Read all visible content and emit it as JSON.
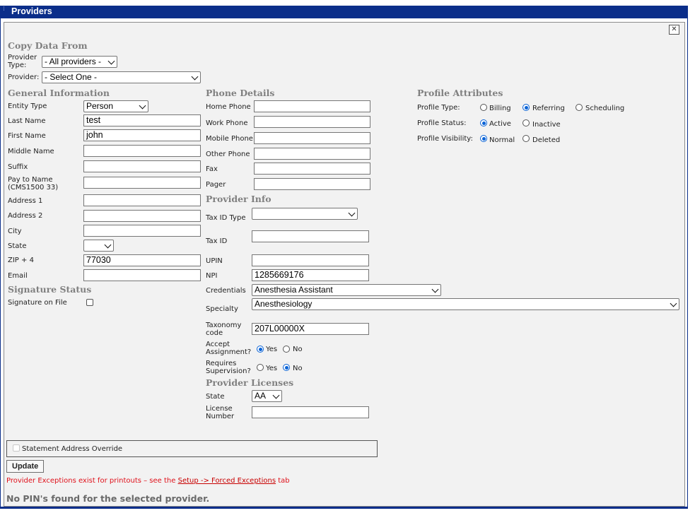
{
  "window": {
    "title": "Providers",
    "close_icon": "close-icon"
  },
  "copy": {
    "heading": "Copy Data From",
    "provider_type_label": "Provider Type:",
    "provider_type_value": "- All providers -",
    "provider_label": "Provider:",
    "provider_value": "- Select One -"
  },
  "general": {
    "heading": "General Information",
    "entity_type_label": "Entity Type",
    "entity_type_value": "Person",
    "last_name_label": "Last Name",
    "last_name_value": "test",
    "first_name_label": "First Name",
    "first_name_value": "john",
    "middle_name_label": "Middle Name",
    "middle_name_value": "",
    "suffix_label": "Suffix",
    "suffix_value": "",
    "pay_to_name_label": "Pay to Name (CMS1500 33)",
    "pay_to_name_value": "",
    "address1_label": "Address 1",
    "address1_value": "",
    "address2_label": "Address 2",
    "address2_value": "",
    "city_label": "City",
    "city_value": "",
    "state_label": "State",
    "state_value": "",
    "zip_label": "ZIP + 4",
    "zip_value": "77030",
    "email_label": "Email",
    "email_value": ""
  },
  "signature": {
    "heading": "Signature Status",
    "on_file_label": "Signature on File",
    "on_file_checked": false
  },
  "phone": {
    "heading": "Phone Details",
    "home_label": "Home Phone",
    "home_value": "",
    "work_label": "Work Phone",
    "work_value": "",
    "mobile_label": "Mobile Phone",
    "mobile_value": "",
    "other_label": "Other Phone",
    "other_value": "",
    "fax_label": "Fax",
    "fax_value": "",
    "pager_label": "Pager",
    "pager_value": ""
  },
  "provider_info": {
    "heading": "Provider Info",
    "tax_id_type_label": "Tax ID Type",
    "tax_id_type_value": "",
    "tax_id_label": "Tax ID",
    "tax_id_value": "",
    "upin_label": "UPIN",
    "upin_value": "",
    "npi_label": "NPI",
    "npi_value": "1285669176",
    "credentials_label": "Credentials",
    "credentials_value": "Anesthesia Assistant",
    "specialty_label": "Specialty",
    "specialty_value": "Anesthesiology",
    "taxonomy_label": "Taxonomy code",
    "taxonomy_value": "207L00000X",
    "accept_assignment_label": "Accept Assignment?",
    "requires_supervision_label": "Requires Supervision?",
    "yes_label": "Yes",
    "no_label": "No",
    "accept_assignment": "Yes",
    "requires_supervision": "No"
  },
  "licenses": {
    "heading": "Provider Licenses",
    "state_label": "State",
    "state_value": "AA",
    "license_number_label": "License Number",
    "license_number_value": ""
  },
  "profile": {
    "heading": "Profile Attributes",
    "type_label": "Profile Type:",
    "type_options": [
      "Billing",
      "Referring",
      "Scheduling"
    ],
    "type_selected": "Referring",
    "status_label": "Profile Status:",
    "status_options": [
      "Active",
      "Inactive"
    ],
    "status_selected": "Active",
    "visibility_label": "Profile Visibility:",
    "visibility_options": [
      "Normal",
      "Deleted"
    ],
    "visibility_selected": "Normal"
  },
  "statement_override": {
    "label": "Statement Address Override",
    "checked": false
  },
  "actions": {
    "update_label": "Update"
  },
  "messages": {
    "exceptions_prefix": "Provider Exceptions exist for printouts – see the ",
    "exceptions_link": "Setup -> Forced Exceptions",
    "exceptions_suffix": " tab",
    "no_pin": "No PIN's found for the selected provider."
  },
  "colors": {
    "title_bar": "#0b2e8a",
    "section_heading": "#808080",
    "warning": "#e0101a",
    "radio_selected": "#0a63d6"
  }
}
